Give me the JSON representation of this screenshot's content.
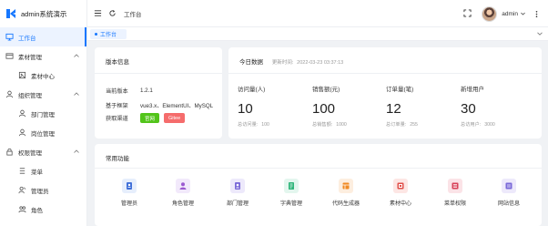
{
  "app": {
    "title": "admin系统演示"
  },
  "sidebar": {
    "items": [
      {
        "label": "工作台",
        "icon": "monitor-icon",
        "active": true
      },
      {
        "label": "素材管理",
        "icon": "box-icon",
        "group": true
      },
      {
        "label": "素材中心",
        "icon": "image-icon",
        "sub": true
      },
      {
        "label": "组织管理",
        "icon": "user-icon",
        "group": true
      },
      {
        "label": "部门管理",
        "icon": "person-icon",
        "sub": true
      },
      {
        "label": "岗位管理",
        "icon": "person-icon",
        "sub": true
      },
      {
        "label": "权限管理",
        "icon": "lock-icon",
        "group": true
      },
      {
        "label": "菜单",
        "icon": "menu-icon",
        "sub": true
      },
      {
        "label": "管理员",
        "icon": "admin-icon",
        "sub": true
      },
      {
        "label": "角色",
        "icon": "role-icon",
        "sub": true
      }
    ]
  },
  "header": {
    "breadcrumb": "工作台",
    "user": "admin"
  },
  "tabs": [
    {
      "label": "工作台"
    }
  ],
  "version": {
    "title": "版本信息",
    "rows": [
      {
        "key": "当前版本",
        "value": "1.2.1"
      },
      {
        "key": "基于框架",
        "value": "vue3.x、ElementUI、MySQL"
      },
      {
        "key": "获取渠道",
        "value": ""
      }
    ],
    "buttons": [
      "官网",
      "Gitee"
    ]
  },
  "today": {
    "title": "今日数据",
    "updated_label": "更新时间:",
    "updated_time": "2022-03-23 03:37:13",
    "stats": [
      {
        "label": "访问量(人)",
        "value": "10",
        "sub_label": "总访问量:",
        "sub_value": "100"
      },
      {
        "label": "销售额(元)",
        "value": "100",
        "sub_label": "总销售额:",
        "sub_value": "1000"
      },
      {
        "label": "订单量(笔)",
        "value": "12",
        "sub_label": "总订单量:",
        "sub_value": "255"
      },
      {
        "label": "新增用户",
        "value": "30",
        "sub_label": "总访用户:",
        "sub_value": "3000"
      }
    ]
  },
  "common": {
    "title": "常用功能",
    "items": [
      {
        "label": "管理员",
        "icon": "admin-icon",
        "color": "#3f6fd8",
        "bg": "#e6eefc"
      },
      {
        "label": "角色管理",
        "icon": "role-icon",
        "color": "#9b59d0",
        "bg": "#f2e9fb"
      },
      {
        "label": "部门管理",
        "icon": "dept-icon",
        "color": "#7b6ad8",
        "bg": "#ede9fb"
      },
      {
        "label": "字典管理",
        "icon": "dict-icon",
        "color": "#2fb57a",
        "bg": "#e3f6ee"
      },
      {
        "label": "代码生成器",
        "icon": "code-icon",
        "color": "#f08a24",
        "bg": "#fdeedf"
      },
      {
        "label": "素材中心",
        "icon": "material-icon",
        "color": "#e1504a",
        "bg": "#fde6e4"
      },
      {
        "label": "菜单权限",
        "icon": "menu-perm-icon",
        "color": "#d8435a",
        "bg": "#fbe3e7"
      },
      {
        "label": "网站信息",
        "icon": "site-icon",
        "color": "#7b6ad8",
        "bg": "#ede9fb"
      }
    ]
  },
  "colors": {
    "primary": "#1677ff",
    "success": "#52c41a",
    "danger": "#f56c6c"
  }
}
